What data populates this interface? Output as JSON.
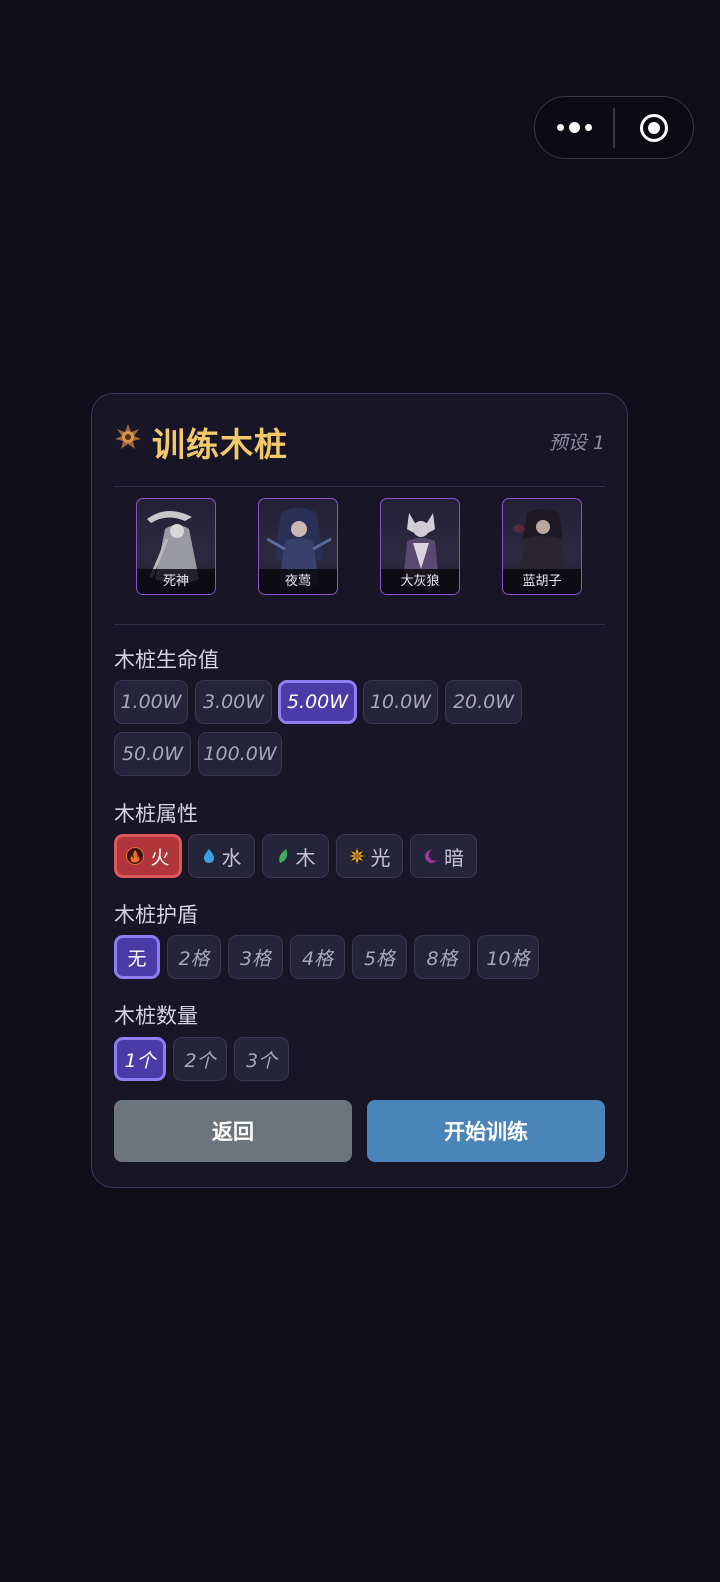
{
  "capsule": {
    "menu_icon": "more-dots-icon",
    "close_icon": "target-close-icon"
  },
  "panel": {
    "title": "训练木桩",
    "title_icon": "spiky-gear-icon",
    "preset": "预设 1",
    "heroes": [
      {
        "name": "死神"
      },
      {
        "name": "夜莺"
      },
      {
        "name": "大灰狼"
      },
      {
        "name": "蓝胡子"
      }
    ],
    "hp": {
      "label": "木桩生命值",
      "options": [
        "1.00W",
        "3.00W",
        "5.00W",
        "10.0W",
        "20.0W",
        "50.0W",
        "100.0W"
      ],
      "selected": "5.00W"
    },
    "attribute": {
      "label": "木桩属性",
      "options": [
        {
          "label": "火",
          "icon": "fire-icon"
        },
        {
          "label": "水",
          "icon": "water-drop-icon"
        },
        {
          "label": "木",
          "icon": "leaf-icon"
        },
        {
          "label": "光",
          "icon": "sun-icon"
        },
        {
          "label": "暗",
          "icon": "moon-icon"
        }
      ],
      "selected": "火"
    },
    "shield": {
      "label": "木桩护盾",
      "options": [
        "无",
        "2格",
        "3格",
        "4格",
        "5格",
        "8格",
        "10格"
      ],
      "selected": "无"
    },
    "count": {
      "label": "木桩数量",
      "options": [
        "1个",
        "2个",
        "3个"
      ],
      "selected": "1个"
    },
    "buttons": {
      "back": "返回",
      "start": "开始训练"
    }
  },
  "colors": {
    "background": "#0f0e1a",
    "title": "#f3c86a",
    "selected_purple": "#4a3ba8",
    "selected_red": "#b0363b",
    "back_button": "#6c757d",
    "start_button": "#4a84b8"
  }
}
